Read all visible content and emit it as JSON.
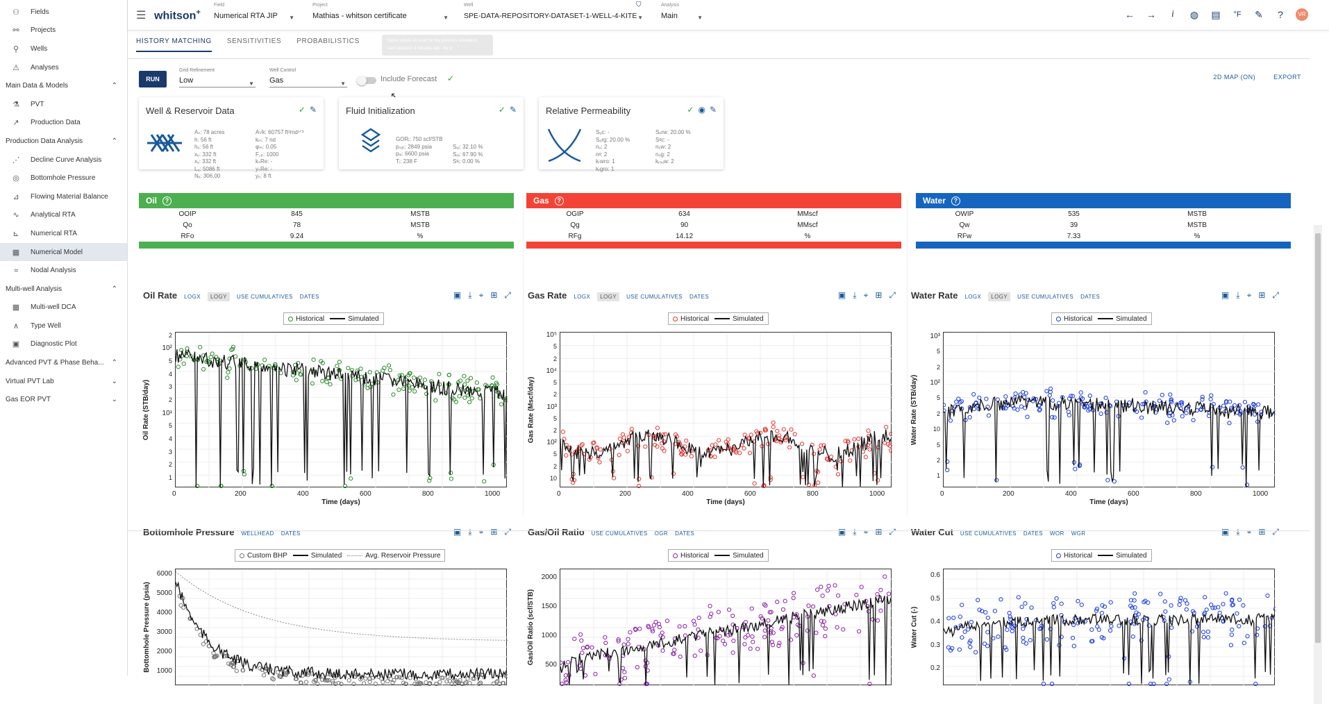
{
  "sidebar": {
    "items": [
      {
        "icon": "fields-icon",
        "label": "Fields"
      },
      {
        "icon": "projects-icon",
        "label": "Projects"
      },
      {
        "icon": "wells-icon",
        "label": "Wells"
      },
      {
        "icon": "analyses-icon",
        "label": "Analyses"
      }
    ],
    "section_main": "Main Data & Models",
    "main_items": [
      {
        "icon": "pvt-icon",
        "label": "PVT"
      },
      {
        "icon": "production-data-icon",
        "label": "Production Data"
      }
    ],
    "section_pda": "Production Data Analysis",
    "pda_items": [
      {
        "icon": "decline-curve-icon",
        "label": "Decline Curve Analysis"
      },
      {
        "icon": "bottomhole-pressure-icon",
        "label": "Bottomhole Pressure"
      },
      {
        "icon": "flowing-material-balance-icon",
        "label": "Flowing Material Balance"
      },
      {
        "icon": "analytical-rta-icon",
        "label": "Analytical RTA"
      },
      {
        "icon": "numerical-rta-icon",
        "label": "Numerical RTA"
      },
      {
        "icon": "numerical-model-icon",
        "label": "Numerical Model"
      },
      {
        "icon": "nodal-analysis-icon",
        "label": "Nodal Analysis"
      }
    ],
    "section_mw": "Multi-well Analysis",
    "mw_items": [
      {
        "icon": "multi-well-dca-icon",
        "label": "Multi-well DCA"
      },
      {
        "icon": "type-well-icon",
        "label": "Type Well"
      },
      {
        "icon": "diagnostic-plot-icon",
        "label": "Diagnostic Plot"
      }
    ],
    "section_adv": "Advanced PVT & Phase Beha...",
    "section_vpl": "Virtual PVT Lab",
    "section_eor": "Gas EOR PVT"
  },
  "topbar": {
    "brand": "whitson",
    "brand_sup": "+",
    "field_label": "Field",
    "field_value": "Numerical RTA JIP",
    "project_label": "Project",
    "project_value": "Mathias - whitson certificate",
    "well_label": "Well",
    "well_value": "SPE-DATA-REPOSITORY-DATASET-1-WELL-4-KITE",
    "analysis_label": "Analysis",
    "analysis_value": "Main",
    "temp_unit": "°F",
    "avatar": "VR"
  },
  "tabs": [
    "HISTORY MATCHING",
    "SENSITIVITIES",
    "PROBABILISTICS"
  ],
  "tooltip": {
    "line1": "Same values as used for the previous simulation.",
    "line2": "Last updated: 3 minutes ago - by vr"
  },
  "controls": {
    "run": "RUN",
    "grid_label": "Grid Refinement",
    "grid_value": "Low",
    "well_control_label": "Well Control",
    "well_control_value": "Gas",
    "include_forecast": "Include Forecast",
    "map_link": "2D MAP (ON)",
    "export_link": "EXPORT"
  },
  "cards": {
    "well": {
      "title": "Well & Reservoir Data",
      "col1": "Aₛ: 78 acres\nh: 56 ft\nhₓ: 56 ft\nxₑ: 332 ft\nxᵧ: 332 ft\nLᵤ: 5086 ft\nNₓ: 306.00",
      "col2": "A√k: 60757 ft²md¹ᐟ²\nkₘ: 7 nd\nφₘ: 0.05\nF꜀ₚ: 1000\nkₛRe: -\nyₛRe: -\nyₑ: 8 ft"
    },
    "fluid": {
      "title": "Fluid Initialization",
      "col1": "GORᵢ: 750 scf/STB\npₛₐₜ: 2849 psia\npᵢₑ: 6600 psia\nTᵢ: 238 F",
      "col2": "\n\nSᵤᵢ: 32.10 %\nSₒᵢ: 67.90 %\nSᵍᵢ: 0.00 %"
    },
    "relperm": {
      "title": "Relative Permeability",
      "col1": "Sᵤc: -\nSₒrg: 20.00 %\nnᵤ: 2\nnᵍ: 2\nkᵣwro: 1\nkᵣgro: 1",
      "col2": "Sₒrw: 20.00 %\nSᵍc: -\nnₒw: 2\nnₒg: 2\nkᵣₒᵤw: 2"
    }
  },
  "summaries": [
    {
      "name": "Oil",
      "color": "#4caf50",
      "rows": [
        [
          "OOIP",
          "845",
          "MSTB"
        ],
        [
          "Qo",
          "78",
          "MSTB"
        ],
        [
          "RFo",
          "9.24",
          "%"
        ]
      ]
    },
    {
      "name": "Gas",
      "color": "#f44336",
      "rows": [
        [
          "OGIP",
          "634",
          "MMscf"
        ],
        [
          "Qg",
          "90",
          "MMscf"
        ],
        [
          "RFg",
          "14.12",
          "%"
        ]
      ]
    },
    {
      "name": "Water",
      "color": "#1565c0",
      "rows": [
        [
          "OWIP",
          "535",
          "MSTB"
        ],
        [
          "Qw",
          "39",
          "MSTB"
        ],
        [
          "RFw",
          "7.33",
          "%"
        ]
      ]
    }
  ],
  "panels": [
    {
      "title": "Oil Rate",
      "links": [
        "LOGX",
        "LOGY",
        "USE CUMULATIVES",
        "DATES"
      ],
      "hl": 1,
      "legend": [
        "Historical",
        "Simulated"
      ],
      "ylabel": "Oil Rate (STB/day)",
      "xlabel": "Time (days)",
      "color": "#2e8b2e",
      "yticks": [
        "2",
        "10²",
        "5",
        "4",
        "3",
        "2",
        "10¹",
        "5",
        "4",
        "3",
        "2",
        "1"
      ],
      "xticks": [
        "0",
        "200",
        "400",
        "600",
        "800",
        "1000"
      ]
    },
    {
      "title": "Gas Rate",
      "links": [
        "LOGX",
        "LOGY",
        "USE CUMULATIVES",
        "DATES"
      ],
      "hl": 1,
      "legend": [
        "Historical",
        "Simulated"
      ],
      "ylabel": "Gas Rate (Mscf/day)",
      "xlabel": "Time (days)",
      "color": "#e53935",
      "yticks": [
        "10⁵",
        "5",
        "2",
        "10⁴",
        "5",
        "2",
        "10³",
        "5",
        "2",
        "10²",
        "5",
        "2",
        "10"
      ],
      "xticks": [
        "0",
        "200",
        "400",
        "600",
        "800",
        "1000"
      ]
    },
    {
      "title": "Water Rate",
      "links": [
        "LOGX",
        "LOGY",
        "USE CUMULATIVES",
        "DATES"
      ],
      "hl": 1,
      "legend": [
        "Historical",
        "Simulated"
      ],
      "ylabel": "Water Rate (STB/day)",
      "xlabel": "Time (days)",
      "color": "#1e3de0",
      "yticks": [
        "10³",
        "5",
        "2",
        "10²",
        "5",
        "2",
        "10",
        "5",
        "2",
        "1"
      ],
      "xticks": [
        "0",
        "200",
        "400",
        "600",
        "800",
        "1000"
      ]
    },
    {
      "title": "Bottomhole Pressure",
      "links": [
        "WELLHEAD",
        "DATES"
      ],
      "hl": -1,
      "legend": [
        "Custom BHP",
        "Simulated",
        "Avg. Reservoir Pressure"
      ],
      "ylabel": "Bottomhole Pressure (psia)",
      "xlabel": "",
      "color": "#777777",
      "yticks": [
        "6000",
        "5000",
        "4000",
        "3000",
        "2000",
        "1000"
      ],
      "xticks": []
    },
    {
      "title": "Gas/Oil Ratio",
      "links": [
        "USE CUMULATIVES",
        "OGR",
        "DATES"
      ],
      "hl": -1,
      "legend": [
        "Historical",
        "Simulated"
      ],
      "ylabel": "Gas/Oil Ratio (scf/STB)",
      "xlabel": "",
      "color": "#8e24aa",
      "yticks": [
        "2000",
        "1500",
        "1000",
        "500"
      ],
      "xticks": []
    },
    {
      "title": "Water Cut",
      "links": [
        "USE CUMULATIVES",
        "DATES",
        "WOR",
        "WGR"
      ],
      "hl": -1,
      "legend": [
        "Historical",
        "Simulated"
      ],
      "ylabel": "Water Cut (-)",
      "xlabel": "",
      "color": "#1e3de0",
      "yticks": [
        "0.6",
        "0.5",
        "0.4",
        "0.3",
        "0.2"
      ],
      "xticks": []
    }
  ]
}
